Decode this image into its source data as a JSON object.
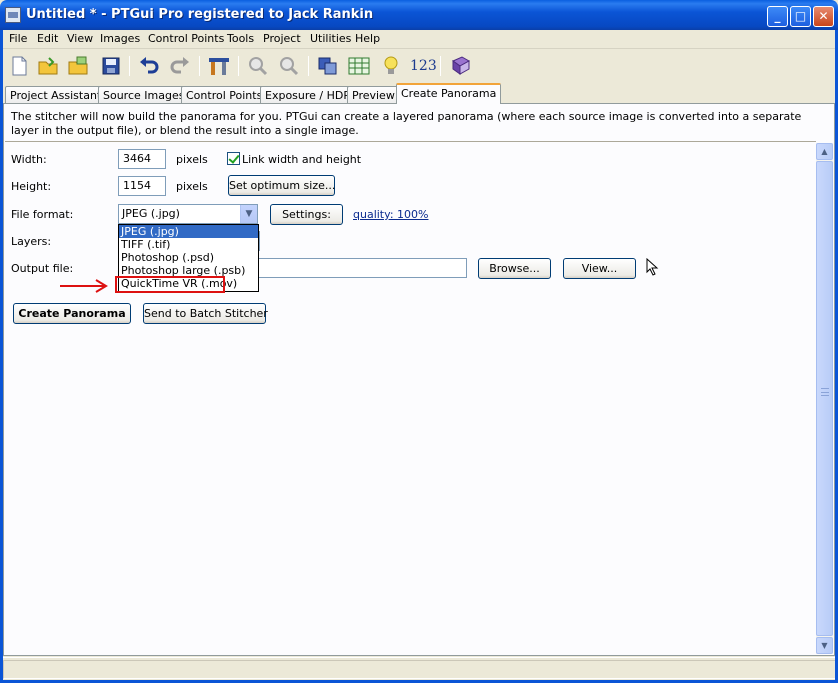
{
  "window": {
    "title": "Untitled * - PTGui Pro registered to Jack Rankin"
  },
  "menu": [
    "File",
    "Edit",
    "View",
    "Images",
    "Control Points",
    "Tools",
    "Project",
    "Utilities",
    "Help"
  ],
  "toolbar": {
    "numbers_label": "123"
  },
  "tabs": [
    "Project Assistant",
    "Source Images",
    "Control Points",
    "Exposure / HDR",
    "Preview",
    "Create Panorama"
  ],
  "active_tab": "Create Panorama",
  "intro": "The stitcher will now build the panorama for you. PTGui can create a layered panorama (where each source image is converted into a separate layer in the output file), or blend the result into a single image.",
  "form": {
    "width_label": "Width:",
    "width_value": "3464",
    "width_unit": "pixels",
    "link_label": "Link width and height",
    "height_label": "Height:",
    "height_value": "1154",
    "height_unit": "pixels",
    "optimum_button": "Set optimum size...",
    "format_label": "File format:",
    "format_value": "JPEG (.jpg)",
    "settings_button": "Settings:",
    "quality_link": "quality: 100%",
    "layers_label": "Layers:",
    "output_label": "Output file:",
    "browse_button": "Browse...",
    "view_button": "View...",
    "create_button": "Create Panorama",
    "batch_button": "Send to Batch Stitcher"
  },
  "format_options": [
    "JPEG (.jpg)",
    "TIFF (.tif)",
    "Photoshop (.psd)",
    "Photoshop large (.psb)",
    "QuickTime VR (.mov)"
  ],
  "colors": {
    "titlebar": "#0b55d6",
    "highlight_box": "#d11111",
    "selection": "#316ac5",
    "tab_accent": "#f2a43a"
  }
}
